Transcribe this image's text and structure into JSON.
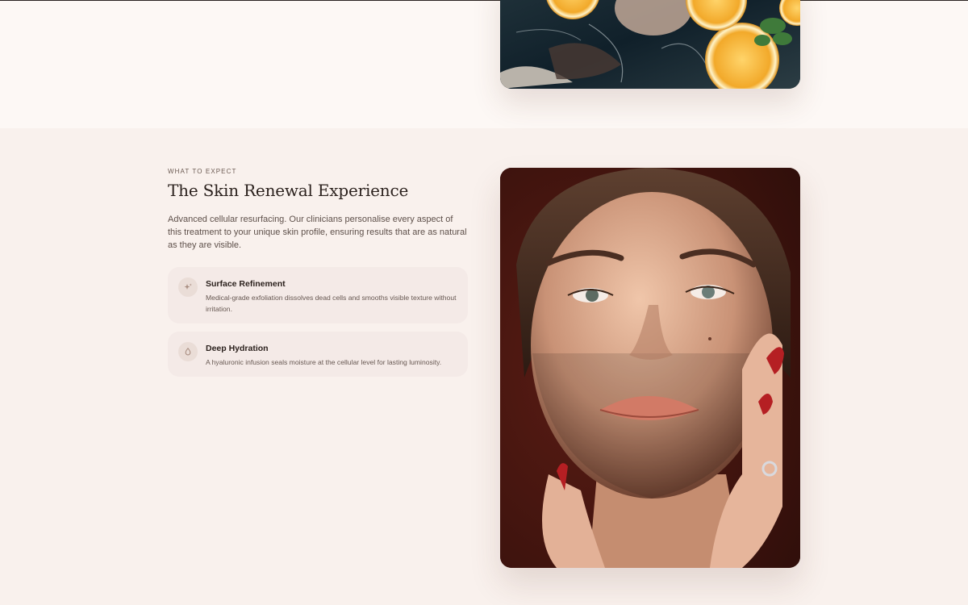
{
  "section": {
    "eyebrow": "WHAT TO EXPECT",
    "title": "The Skin Renewal Experience",
    "intro": "Advanced cellular resurfacing. Our clinicians personalise every aspect of this treatment to your unique skin profile, ensuring results that are as natural as they are visible."
  },
  "features": [
    {
      "icon": "sparkle-icon",
      "title": "Surface Refinement",
      "description": "Medical-grade exfoliation dissolves dead cells and smooths visible texture without irritation."
    },
    {
      "icon": "water-drop-icon",
      "title": "Deep Hydration",
      "description": "A hyaluronic infusion seals moisture at the cellular level for lasting luminosity."
    }
  ],
  "colors": {
    "page_background": "#fcf7f4",
    "section_background": "#f9f1ed",
    "card_background": "#f4eae7",
    "heading_text": "#2b211d",
    "body_text": "#5e504a",
    "icon_accent": "#a88d80"
  }
}
